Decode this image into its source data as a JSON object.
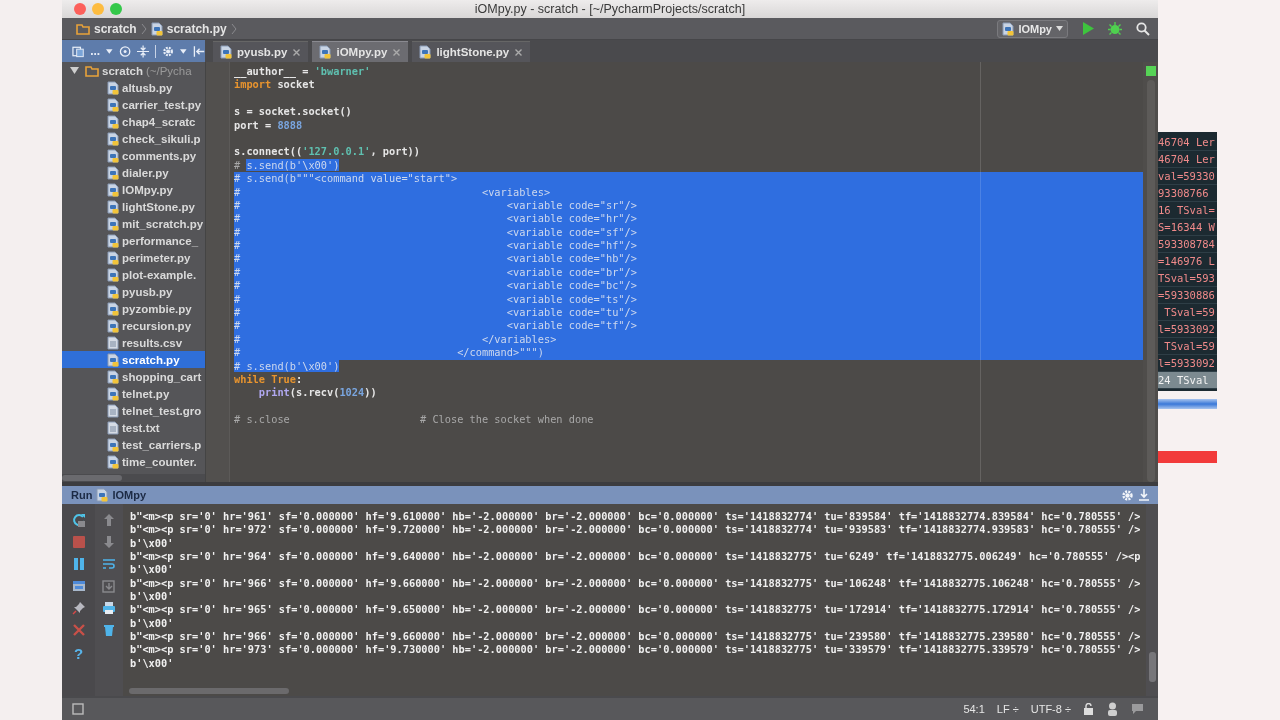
{
  "window": {
    "title": "iOMpy.py - scratch - [~/PycharmProjects/scratch]"
  },
  "breadcrumbs": [
    {
      "kind": "folder",
      "label": "scratch"
    },
    {
      "kind": "python",
      "label": "scratch.py"
    }
  ],
  "run_config": {
    "label": "IOMpy"
  },
  "project_view": {
    "label": "..."
  },
  "tabs": [
    {
      "label": "pyusb.py",
      "selected": false
    },
    {
      "label": "iOMpy.py",
      "selected": true
    },
    {
      "label": "lightStone.py",
      "selected": false
    }
  ],
  "project_tree": {
    "label": "scratch",
    "path": "(~/Pycha",
    "expanded": true,
    "children": [
      {
        "label": "altusb.py",
        "kind": "python",
        "selected": false
      },
      {
        "label": "carrier_test.py",
        "kind": "python",
        "selected": false
      },
      {
        "label": "chap4_scratc",
        "kind": "python",
        "selected": false
      },
      {
        "label": "check_sikuli.p",
        "kind": "python",
        "selected": false
      },
      {
        "label": "comments.py",
        "kind": "python",
        "selected": false
      },
      {
        "label": "dialer.py",
        "kind": "python",
        "selected": false
      },
      {
        "label": "IOMpy.py",
        "kind": "python",
        "selected": false
      },
      {
        "label": "lightStone.py",
        "kind": "python",
        "selected": false
      },
      {
        "label": "mit_scratch.py",
        "kind": "python",
        "selected": false
      },
      {
        "label": "performance_",
        "kind": "python",
        "selected": false
      },
      {
        "label": "perimeter.py",
        "kind": "python",
        "selected": false
      },
      {
        "label": "plot-example.",
        "kind": "python",
        "selected": false
      },
      {
        "label": "pyusb.py",
        "kind": "python",
        "selected": false
      },
      {
        "label": "pyzombie.py",
        "kind": "python",
        "selected": false
      },
      {
        "label": "recursion.py",
        "kind": "python",
        "selected": false
      },
      {
        "label": "results.csv",
        "kind": "text",
        "selected": false
      },
      {
        "label": "scratch.py",
        "kind": "python",
        "selected": true
      },
      {
        "label": "shopping_cart",
        "kind": "python",
        "selected": false
      },
      {
        "label": "telnet.py",
        "kind": "python",
        "selected": false
      },
      {
        "label": "telnet_test.gro",
        "kind": "text",
        "selected": false
      },
      {
        "label": "test.txt",
        "kind": "text",
        "selected": false
      },
      {
        "label": "test_carriers.p",
        "kind": "python",
        "selected": false
      },
      {
        "label": "time_counter.",
        "kind": "python",
        "selected": false
      }
    ]
  },
  "editor": {
    "lines": [
      {
        "kind": "code",
        "row_selected": false,
        "segments": [
          {
            "kind": "plain",
            "text": "__author__ = ",
            "selected": false
          },
          {
            "kind": "string",
            "text": "'bwarner'",
            "selected": false
          }
        ]
      },
      {
        "kind": "code",
        "row_selected": false,
        "segments": [
          {
            "kind": "keyword",
            "text": "import",
            "selected": false
          },
          {
            "kind": "plain",
            "text": " socket",
            "selected": false
          }
        ]
      },
      {
        "kind": "blank"
      },
      {
        "kind": "code",
        "row_selected": false,
        "segments": [
          {
            "kind": "plain",
            "text": "s = socket.socket()",
            "selected": false
          }
        ]
      },
      {
        "kind": "code",
        "row_selected": false,
        "segments": [
          {
            "kind": "plain",
            "text": "port = ",
            "selected": false
          },
          {
            "kind": "number",
            "text": "8888",
            "selected": false
          }
        ]
      },
      {
        "kind": "blank"
      },
      {
        "kind": "code",
        "row_selected": false,
        "segments": [
          {
            "kind": "plain",
            "text": "s.connect((",
            "selected": false
          },
          {
            "kind": "string",
            "text": "'127.0.0.1'",
            "selected": false
          },
          {
            "kind": "plain",
            "text": ", port))",
            "selected": false
          }
        ]
      },
      {
        "kind": "code",
        "row_selected": false,
        "segments": [
          {
            "kind": "comment",
            "text": "# ",
            "selected": false
          },
          {
            "kind": "comment",
            "text": "s.send(b'\\x00')",
            "selected": true
          }
        ]
      },
      {
        "kind": "code",
        "row_selected": true,
        "segments": [
          {
            "kind": "comment",
            "text": "# s.send(b\"\"\"<command value=\"start\">",
            "selected": true
          }
        ]
      },
      {
        "kind": "code",
        "row_selected": true,
        "segments": [
          {
            "kind": "comment",
            "text": "#                                       <variables>",
            "selected": true
          }
        ]
      },
      {
        "kind": "code",
        "row_selected": true,
        "segments": [
          {
            "kind": "comment",
            "text": "#                                           <variable code=\"sr\"/>",
            "selected": true
          }
        ]
      },
      {
        "kind": "code",
        "row_selected": true,
        "segments": [
          {
            "kind": "comment",
            "text": "#                                           <variable code=\"hr\"/>",
            "selected": true
          }
        ]
      },
      {
        "kind": "code",
        "row_selected": true,
        "segments": [
          {
            "kind": "comment",
            "text": "#                                           <variable code=\"sf\"/>",
            "selected": true
          }
        ]
      },
      {
        "kind": "code",
        "row_selected": true,
        "segments": [
          {
            "kind": "comment",
            "text": "#                                           <variable code=\"hf\"/>",
            "selected": true
          }
        ]
      },
      {
        "kind": "code",
        "row_selected": true,
        "segments": [
          {
            "kind": "comment",
            "text": "#                                           <variable code=\"hb\"/>",
            "selected": true
          }
        ]
      },
      {
        "kind": "code",
        "row_selected": true,
        "segments": [
          {
            "kind": "comment",
            "text": "#                                           <variable code=\"br\"/>",
            "selected": true
          }
        ]
      },
      {
        "kind": "code",
        "row_selected": true,
        "segments": [
          {
            "kind": "comment",
            "text": "#                                           <variable code=\"bc\"/>",
            "selected": true
          }
        ]
      },
      {
        "kind": "code",
        "row_selected": true,
        "segments": [
          {
            "kind": "comment",
            "text": "#                                           <variable code=\"ts\"/>",
            "selected": true
          }
        ]
      },
      {
        "kind": "code",
        "row_selected": true,
        "segments": [
          {
            "kind": "comment",
            "text": "#                                           <variable code=\"tu\"/>",
            "selected": true
          }
        ]
      },
      {
        "kind": "code",
        "row_selected": true,
        "segments": [
          {
            "kind": "comment",
            "text": "#                                           <variable code=\"tf\"/>",
            "selected": true
          }
        ]
      },
      {
        "kind": "code",
        "row_selected": true,
        "segments": [
          {
            "kind": "comment",
            "text": "#                                       </variables>",
            "selected": true
          }
        ]
      },
      {
        "kind": "code",
        "row_selected": true,
        "segments": [
          {
            "kind": "comment",
            "text": "#                                   </command>\"\"\")",
            "selected": true
          }
        ]
      },
      {
        "kind": "code",
        "row_selected": false,
        "segments": [
          {
            "kind": "comment",
            "text": "# s.send(b'\\x00')",
            "selected": true
          }
        ]
      },
      {
        "kind": "code",
        "row_selected": false,
        "segments": [
          {
            "kind": "keyword",
            "text": "while",
            "selected": false
          },
          {
            "kind": "keyword",
            "text": " True",
            "selected": false
          },
          {
            "kind": "plain",
            "text": ":",
            "selected": false
          }
        ]
      },
      {
        "kind": "code",
        "row_selected": false,
        "segments": [
          {
            "kind": "builtin",
            "text": "    print",
            "selected": false
          },
          {
            "kind": "plain",
            "text": "(s.recv(",
            "selected": false
          },
          {
            "kind": "number",
            "text": "1024",
            "selected": false
          },
          {
            "kind": "plain",
            "text": "))",
            "selected": false
          }
        ]
      },
      {
        "kind": "blank"
      },
      {
        "kind": "code",
        "row_selected": false,
        "segments": [
          {
            "kind": "comment",
            "text": "# s.close                     # Close the socket when done",
            "selected": false
          }
        ]
      }
    ]
  },
  "run_panel": {
    "title": "Run",
    "config": "IOMpy",
    "help": "?",
    "output": [
      "b\"<m><p sr='0' hr='961' sf='0.000000' hf='9.610000' hb='-2.000000' br='-2.000000' bc='0.000000' ts='1418832774' tu='839584' tf='1418832774.839584' hc='0.780555' />",
      "b\"<m><p sr='0' hr='972' sf='0.000000' hf='9.720000' hb='-2.000000' br='-2.000000' bc='0.000000' ts='1418832774' tu='939583' tf='1418832774.939583' hc='0.780555' />",
      "b'\\x00'",
      "b\"<m><p sr='0' hr='964' sf='0.000000' hf='9.640000' hb='-2.000000' br='-2.000000' bc='0.000000' ts='1418832775' tu='6249' tf='1418832775.006249' hc='0.780555' /><p",
      "b'\\x00'",
      "b\"<m><p sr='0' hr='966' sf='0.000000' hf='9.660000' hb='-2.000000' br='-2.000000' bc='0.000000' ts='1418832775' tu='106248' tf='1418832775.106248' hc='0.780555' />",
      "b'\\x00'",
      "b\"<m><p sr='0' hr='965' sf='0.000000' hf='9.650000' hb='-2.000000' br='-2.000000' bc='0.000000' ts='1418832775' tu='172914' tf='1418832775.172914' hc='0.780555' />",
      "b'\\x00'",
      "b\"<m><p sr='0' hr='966' sf='0.000000' hf='9.660000' hb='-2.000000' br='-2.000000' bc='0.000000' ts='1418832775' tu='239580' tf='1418832775.239580' hc='0.780555' />",
      "b\"<m><p sr='0' hr='973' sf='0.000000' hf='9.730000' hb='-2.000000' br='-2.000000' bc='0.000000' ts='1418832775' tu='339579' tf='1418832775.339579' hc='0.780555' />",
      "b'\\x00'"
    ]
  },
  "status_bar": {
    "position": "54:1",
    "line_separator": "LF ÷",
    "encoding": "UTF-8 ÷"
  },
  "background_terminal": {
    "lines": [
      {
        "text": "46704 Ler",
        "selected": false
      },
      {
        "text": "46704 Ler",
        "selected": false
      },
      {
        "text": "val=59330",
        "selected": false
      },
      {
        "text": "93308766",
        "selected": false
      },
      {
        "text": "16 TSval=",
        "selected": false
      },
      {
        "text": "S=16344 W",
        "selected": false
      },
      {
        "text": "593308784",
        "selected": false
      },
      {
        "text": "=146976 L",
        "selected": false
      },
      {
        "text": "TSval=593",
        "selected": false
      },
      {
        "text": "=59330886",
        "selected": false
      },
      {
        "text": " TSval=59",
        "selected": false
      },
      {
        "text": "l=5933092",
        "selected": false
      },
      {
        "text": " TSval=59",
        "selected": false
      },
      {
        "text": "l=5933092",
        "selected": false
      },
      {
        "text": "24 TSval",
        "selected": true
      }
    ]
  }
}
